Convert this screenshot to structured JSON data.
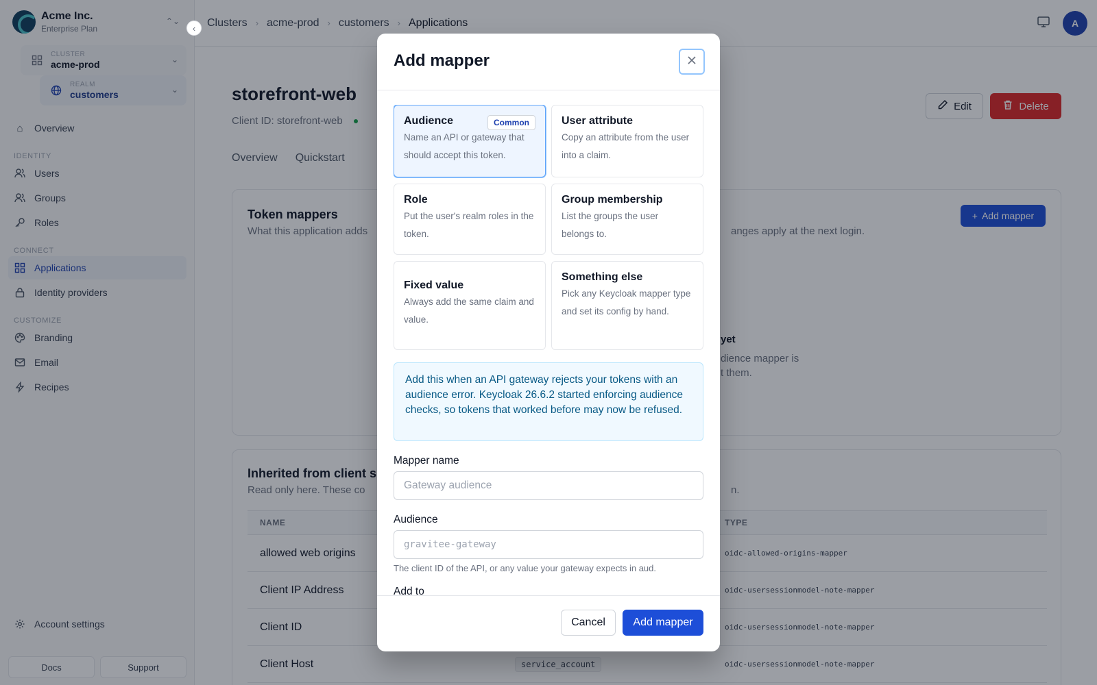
{
  "org": {
    "name": "Acme Inc.",
    "plan": "Enterprise Plan"
  },
  "scope": {
    "cluster_label": "CLUSTER",
    "cluster_value": "acme-prod",
    "realm_label": "REALM",
    "realm_value": "customers"
  },
  "nav": {
    "overview": "Overview",
    "section_identity": "IDENTITY",
    "users": "Users",
    "groups": "Groups",
    "roles": "Roles",
    "section_connect": "CONNECT",
    "applications": "Applications",
    "identity_providers": "Identity providers",
    "section_customize": "CUSTOMIZE",
    "branding": "Branding",
    "email": "Email",
    "recipes": "Recipes",
    "account_settings": "Account settings",
    "docs": "Docs",
    "support": "Support"
  },
  "breadcrumb": [
    "Clusters",
    "acme-prod",
    "customers",
    "Applications"
  ],
  "avatar_initial": "A",
  "page": {
    "title": "storefront-web",
    "client_id": "Client ID: storefront-web",
    "edit": "Edit",
    "delete": "Delete",
    "tabs": [
      "Overview",
      "Quickstart"
    ]
  },
  "token_mappers": {
    "title": "Token mappers",
    "subtitle": "What this application adds",
    "subtitle_tail": "anges apply at the next login.",
    "add_button": "Add mapper",
    "empty_title": "yet",
    "empty_desc_1": "dience mapper is",
    "empty_desc_2": "t them."
  },
  "inherited": {
    "title": "Inherited from client s",
    "subtitle": "Read only here. These co",
    "subtitle_tail": "n.",
    "columns": {
      "name": "NAME",
      "type": "TYPE"
    },
    "rows": [
      {
        "name": "allowed web origins",
        "scope": "",
        "type": "oidc-allowed-origins-mapper"
      },
      {
        "name": "Client IP Address",
        "scope": "",
        "type": "oidc-usersessionmodel-note-mapper"
      },
      {
        "name": "Client ID",
        "scope": "",
        "type": "oidc-usersessionmodel-note-mapper"
      },
      {
        "name": "Client Host",
        "scope": "service_account",
        "type": "oidc-usersessionmodel-note-mapper"
      }
    ]
  },
  "modal": {
    "title": "Add mapper",
    "options": [
      {
        "title": "Audience",
        "badge": "Common",
        "desc": "Name an API or gateway that should accept this token."
      },
      {
        "title": "User attribute",
        "desc": "Copy an attribute from the user into a claim."
      },
      {
        "title": "Role",
        "desc": "Put the user's realm roles in the token."
      },
      {
        "title": "Group membership",
        "desc": "List the groups the user belongs to."
      },
      {
        "title": "Fixed value",
        "desc": "Always add the same claim and value."
      },
      {
        "title": "Something else",
        "desc": "Pick any Keycloak mapper type and set its config by hand."
      }
    ],
    "info": "Add this when an API gateway rejects your tokens with an audience error. Keycloak 26.6.2 started enforcing audience checks, so tokens that worked before may now be refused.",
    "mapper_name_label": "Mapper name",
    "mapper_name_placeholder": "Gateway audience",
    "audience_label": "Audience",
    "audience_placeholder": "gravitee-gateway",
    "audience_help": "The client ID of the API, or any value your gateway expects in aud.",
    "add_to_label": "Add to",
    "cancel": "Cancel",
    "submit": "Add mapper"
  },
  "colors": {
    "primary": "#1d4ed8",
    "danger": "#dc2626",
    "info_bg": "#f0f9ff",
    "info_text": "#075985"
  }
}
